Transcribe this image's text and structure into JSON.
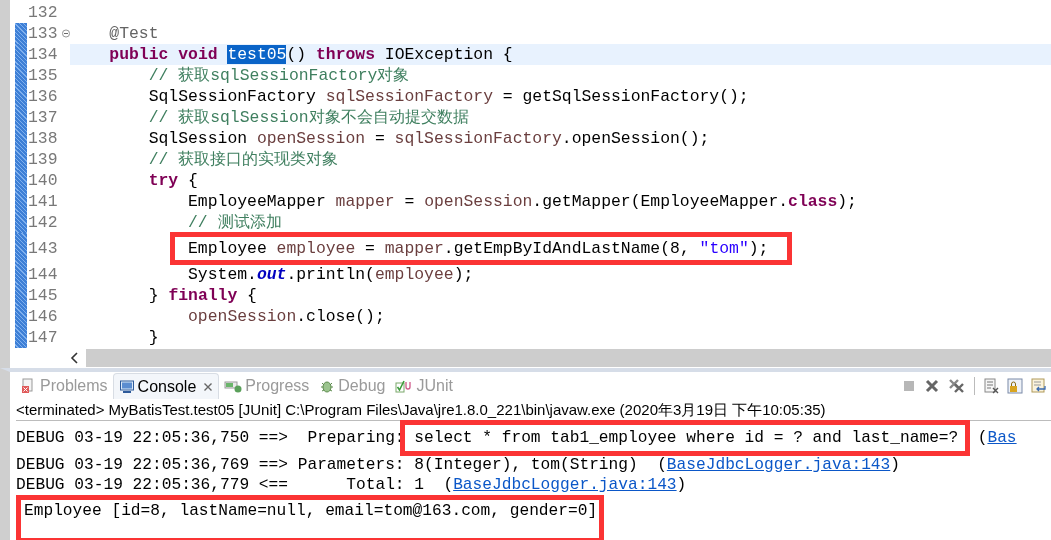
{
  "editor": {
    "lines": [
      {
        "number": "132",
        "changed": false,
        "fold": false,
        "current": false,
        "framed": false
      },
      {
        "number": "133",
        "changed": true,
        "fold": true,
        "current": false,
        "framed": false,
        "tokens": [
          {
            "text": "    @Test",
            "kind": "annotation"
          }
        ]
      },
      {
        "number": "134",
        "changed": true,
        "fold": false,
        "current": true,
        "framed": false,
        "tokens": [
          {
            "text": "    public",
            "kind": "keyword"
          },
          {
            "text": " void ",
            "kind": "keyword"
          },
          {
            "text": "test05",
            "kind": "selection"
          },
          {
            "text": "() ",
            "kind": "plain"
          },
          {
            "text": "throws",
            "kind": "keyword"
          },
          {
            "text": " IOException {",
            "kind": "plain"
          }
        ]
      },
      {
        "number": "135",
        "changed": true,
        "fold": false,
        "current": false,
        "framed": false,
        "tokens": [
          {
            "text": "        // 获取sqlSessionFactory对象",
            "kind": "comment"
          }
        ]
      },
      {
        "number": "136",
        "changed": true,
        "fold": false,
        "current": false,
        "framed": false,
        "tokens": [
          {
            "text": "        SqlSessionFactory ",
            "kind": "plain"
          },
          {
            "text": "sqlSessionFactory",
            "kind": "variable"
          },
          {
            "text": " = getSqlSessionFactory();",
            "kind": "plain"
          }
        ]
      },
      {
        "number": "137",
        "changed": true,
        "fold": false,
        "current": false,
        "framed": false,
        "tokens": [
          {
            "text": "        // 获取sqlSession对象不会自动提交数据",
            "kind": "comment"
          }
        ]
      },
      {
        "number": "138",
        "changed": true,
        "fold": false,
        "current": false,
        "framed": false,
        "tokens": [
          {
            "text": "        SqlSession ",
            "kind": "plain"
          },
          {
            "text": "openSession",
            "kind": "variable"
          },
          {
            "text": " = ",
            "kind": "plain"
          },
          {
            "text": "sqlSessionFactory",
            "kind": "variable"
          },
          {
            "text": ".openSession();",
            "kind": "plain"
          }
        ]
      },
      {
        "number": "139",
        "changed": true,
        "fold": false,
        "current": false,
        "framed": false,
        "tokens": [
          {
            "text": "        // 获取接口的实现类对象",
            "kind": "comment"
          }
        ]
      },
      {
        "number": "140",
        "changed": true,
        "fold": false,
        "current": false,
        "framed": false,
        "tokens": [
          {
            "text": "        try",
            "kind": "keyword"
          },
          {
            "text": " {",
            "kind": "plain"
          }
        ]
      },
      {
        "number": "141",
        "changed": true,
        "fold": false,
        "current": false,
        "framed": false,
        "tokens": [
          {
            "text": "            EmployeeMapper ",
            "kind": "plain"
          },
          {
            "text": "mapper",
            "kind": "variable"
          },
          {
            "text": " = ",
            "kind": "plain"
          },
          {
            "text": "openSession",
            "kind": "variable"
          },
          {
            "text": ".getMapper(EmployeeMapper.",
            "kind": "plain"
          },
          {
            "text": "class",
            "kind": "keyword"
          },
          {
            "text": ");",
            "kind": "plain"
          }
        ]
      },
      {
        "number": "142",
        "changed": true,
        "fold": false,
        "current": false,
        "framed": false,
        "tokens": [
          {
            "text": "            // 测试添加",
            "kind": "comment"
          }
        ]
      },
      {
        "number": "143",
        "changed": true,
        "fold": false,
        "current": false,
        "framed": true,
        "tokens": [
          {
            "text": "            Employee ",
            "kind": "plain"
          },
          {
            "text": "employee",
            "kind": "variable"
          },
          {
            "text": " = ",
            "kind": "plain"
          },
          {
            "text": "mapper",
            "kind": "variable"
          },
          {
            "text": ".getEmpByIdAndLastName(8, ",
            "kind": "plain"
          },
          {
            "text": "\"tom\"",
            "kind": "string"
          },
          {
            "text": ");",
            "kind": "plain"
          }
        ]
      },
      {
        "number": "144",
        "changed": true,
        "fold": false,
        "current": false,
        "framed": false,
        "tokens": [
          {
            "text": "            System.",
            "kind": "plain"
          },
          {
            "text": "out",
            "kind": "field"
          },
          {
            "text": ".println(",
            "kind": "plain"
          },
          {
            "text": "employee",
            "kind": "variable"
          },
          {
            "text": ");",
            "kind": "plain"
          }
        ]
      },
      {
        "number": "145",
        "changed": true,
        "fold": false,
        "current": false,
        "framed": false,
        "tokens": [
          {
            "text": "        } ",
            "kind": "plain"
          },
          {
            "text": "finally",
            "kind": "keyword"
          },
          {
            "text": " {",
            "kind": "plain"
          }
        ]
      },
      {
        "number": "146",
        "changed": true,
        "fold": false,
        "current": false,
        "framed": false,
        "tokens": [
          {
            "text": "            openSession",
            "kind": "variable"
          },
          {
            "text": ".close();",
            "kind": "plain"
          }
        ]
      },
      {
        "number": "147",
        "changed": true,
        "fold": false,
        "current": false,
        "framed": false,
        "tokens": [
          {
            "text": "        }",
            "kind": "plain"
          }
        ]
      }
    ]
  },
  "panel": {
    "tabs": [
      {
        "label": "Problems",
        "kind": "problems",
        "selected": false
      },
      {
        "label": "Console",
        "kind": "console",
        "selected": true
      },
      {
        "label": "Progress",
        "kind": "progress",
        "selected": false
      },
      {
        "label": "Debug",
        "kind": "debug",
        "selected": false
      },
      {
        "label": "JUnit",
        "kind": "junit",
        "selected": false
      }
    ],
    "toolbar": [
      {
        "kind": "terminate",
        "disabled": true
      },
      {
        "kind": "remove",
        "disabled": false
      },
      {
        "kind": "remove-all",
        "disabled": false
      },
      {
        "kind": "clear",
        "disabled": false
      },
      {
        "kind": "scroll-lock",
        "disabled": false
      },
      {
        "kind": "word-wrap",
        "disabled": false
      }
    ],
    "console_title": "<terminated> MyBatisTest.test05 [JUnit] C:\\Program Files\\Java\\jre1.8.0_221\\bin\\javaw.exe (2020年3月19日 下午10:05:35)",
    "console_lines": [
      {
        "framed": false,
        "tokens": [
          {
            "text": "DEBUG 03-19 22:05:36,750 ==>  Preparing: ",
            "kind": "plain"
          },
          {
            "text": "select * from tab1_employee where id = ? and last_name=?",
            "kind": "framed"
          },
          {
            "text": "  (",
            "kind": "plain"
          },
          {
            "text": "Bas",
            "kind": "link"
          }
        ]
      },
      {
        "framed": false,
        "tokens": [
          {
            "text": "DEBUG 03-19 22:05:36,769 ==> Parameters: 8(Integer), tom(String)  (",
            "kind": "plain"
          },
          {
            "text": "BaseJdbcLogger.java:143",
            "kind": "link"
          },
          {
            "text": ")",
            "kind": "plain"
          }
        ]
      },
      {
        "framed": false,
        "tokens": [
          {
            "text": "DEBUG 03-19 22:05:36,779 <==      Total: 1  (",
            "kind": "plain"
          },
          {
            "text": "BaseJdbcLogger.java:143",
            "kind": "link"
          },
          {
            "text": ")",
            "kind": "plain"
          }
        ]
      },
      {
        "framed": true,
        "tokens": [
          {
            "text": "Employee [id=8, lastName=null, email=tom@163.com, gender=0]",
            "kind": "plain"
          }
        ]
      }
    ]
  }
}
